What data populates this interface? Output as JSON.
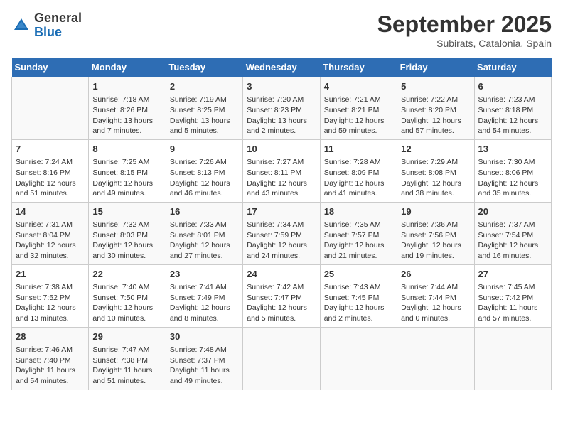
{
  "logo": {
    "general": "General",
    "blue": "Blue"
  },
  "title": "September 2025",
  "subtitle": "Subirats, Catalonia, Spain",
  "weekdays": [
    "Sunday",
    "Monday",
    "Tuesday",
    "Wednesday",
    "Thursday",
    "Friday",
    "Saturday"
  ],
  "weeks": [
    [
      {
        "day": "",
        "info": ""
      },
      {
        "day": "1",
        "info": "Sunrise: 7:18 AM\nSunset: 8:26 PM\nDaylight: 13 hours\nand 7 minutes."
      },
      {
        "day": "2",
        "info": "Sunrise: 7:19 AM\nSunset: 8:25 PM\nDaylight: 13 hours\nand 5 minutes."
      },
      {
        "day": "3",
        "info": "Sunrise: 7:20 AM\nSunset: 8:23 PM\nDaylight: 13 hours\nand 2 minutes."
      },
      {
        "day": "4",
        "info": "Sunrise: 7:21 AM\nSunset: 8:21 PM\nDaylight: 12 hours\nand 59 minutes."
      },
      {
        "day": "5",
        "info": "Sunrise: 7:22 AM\nSunset: 8:20 PM\nDaylight: 12 hours\nand 57 minutes."
      },
      {
        "day": "6",
        "info": "Sunrise: 7:23 AM\nSunset: 8:18 PM\nDaylight: 12 hours\nand 54 minutes."
      }
    ],
    [
      {
        "day": "7",
        "info": "Sunrise: 7:24 AM\nSunset: 8:16 PM\nDaylight: 12 hours\nand 51 minutes."
      },
      {
        "day": "8",
        "info": "Sunrise: 7:25 AM\nSunset: 8:15 PM\nDaylight: 12 hours\nand 49 minutes."
      },
      {
        "day": "9",
        "info": "Sunrise: 7:26 AM\nSunset: 8:13 PM\nDaylight: 12 hours\nand 46 minutes."
      },
      {
        "day": "10",
        "info": "Sunrise: 7:27 AM\nSunset: 8:11 PM\nDaylight: 12 hours\nand 43 minutes."
      },
      {
        "day": "11",
        "info": "Sunrise: 7:28 AM\nSunset: 8:09 PM\nDaylight: 12 hours\nand 41 minutes."
      },
      {
        "day": "12",
        "info": "Sunrise: 7:29 AM\nSunset: 8:08 PM\nDaylight: 12 hours\nand 38 minutes."
      },
      {
        "day": "13",
        "info": "Sunrise: 7:30 AM\nSunset: 8:06 PM\nDaylight: 12 hours\nand 35 minutes."
      }
    ],
    [
      {
        "day": "14",
        "info": "Sunrise: 7:31 AM\nSunset: 8:04 PM\nDaylight: 12 hours\nand 32 minutes."
      },
      {
        "day": "15",
        "info": "Sunrise: 7:32 AM\nSunset: 8:03 PM\nDaylight: 12 hours\nand 30 minutes."
      },
      {
        "day": "16",
        "info": "Sunrise: 7:33 AM\nSunset: 8:01 PM\nDaylight: 12 hours\nand 27 minutes."
      },
      {
        "day": "17",
        "info": "Sunrise: 7:34 AM\nSunset: 7:59 PM\nDaylight: 12 hours\nand 24 minutes."
      },
      {
        "day": "18",
        "info": "Sunrise: 7:35 AM\nSunset: 7:57 PM\nDaylight: 12 hours\nand 21 minutes."
      },
      {
        "day": "19",
        "info": "Sunrise: 7:36 AM\nSunset: 7:56 PM\nDaylight: 12 hours\nand 19 minutes."
      },
      {
        "day": "20",
        "info": "Sunrise: 7:37 AM\nSunset: 7:54 PM\nDaylight: 12 hours\nand 16 minutes."
      }
    ],
    [
      {
        "day": "21",
        "info": "Sunrise: 7:38 AM\nSunset: 7:52 PM\nDaylight: 12 hours\nand 13 minutes."
      },
      {
        "day": "22",
        "info": "Sunrise: 7:40 AM\nSunset: 7:50 PM\nDaylight: 12 hours\nand 10 minutes."
      },
      {
        "day": "23",
        "info": "Sunrise: 7:41 AM\nSunset: 7:49 PM\nDaylight: 12 hours\nand 8 minutes."
      },
      {
        "day": "24",
        "info": "Sunrise: 7:42 AM\nSunset: 7:47 PM\nDaylight: 12 hours\nand 5 minutes."
      },
      {
        "day": "25",
        "info": "Sunrise: 7:43 AM\nSunset: 7:45 PM\nDaylight: 12 hours\nand 2 minutes."
      },
      {
        "day": "26",
        "info": "Sunrise: 7:44 AM\nSunset: 7:44 PM\nDaylight: 12 hours\nand 0 minutes."
      },
      {
        "day": "27",
        "info": "Sunrise: 7:45 AM\nSunset: 7:42 PM\nDaylight: 11 hours\nand 57 minutes."
      }
    ],
    [
      {
        "day": "28",
        "info": "Sunrise: 7:46 AM\nSunset: 7:40 PM\nDaylight: 11 hours\nand 54 minutes."
      },
      {
        "day": "29",
        "info": "Sunrise: 7:47 AM\nSunset: 7:38 PM\nDaylight: 11 hours\nand 51 minutes."
      },
      {
        "day": "30",
        "info": "Sunrise: 7:48 AM\nSunset: 7:37 PM\nDaylight: 11 hours\nand 49 minutes."
      },
      {
        "day": "",
        "info": ""
      },
      {
        "day": "",
        "info": ""
      },
      {
        "day": "",
        "info": ""
      },
      {
        "day": "",
        "info": ""
      }
    ]
  ]
}
